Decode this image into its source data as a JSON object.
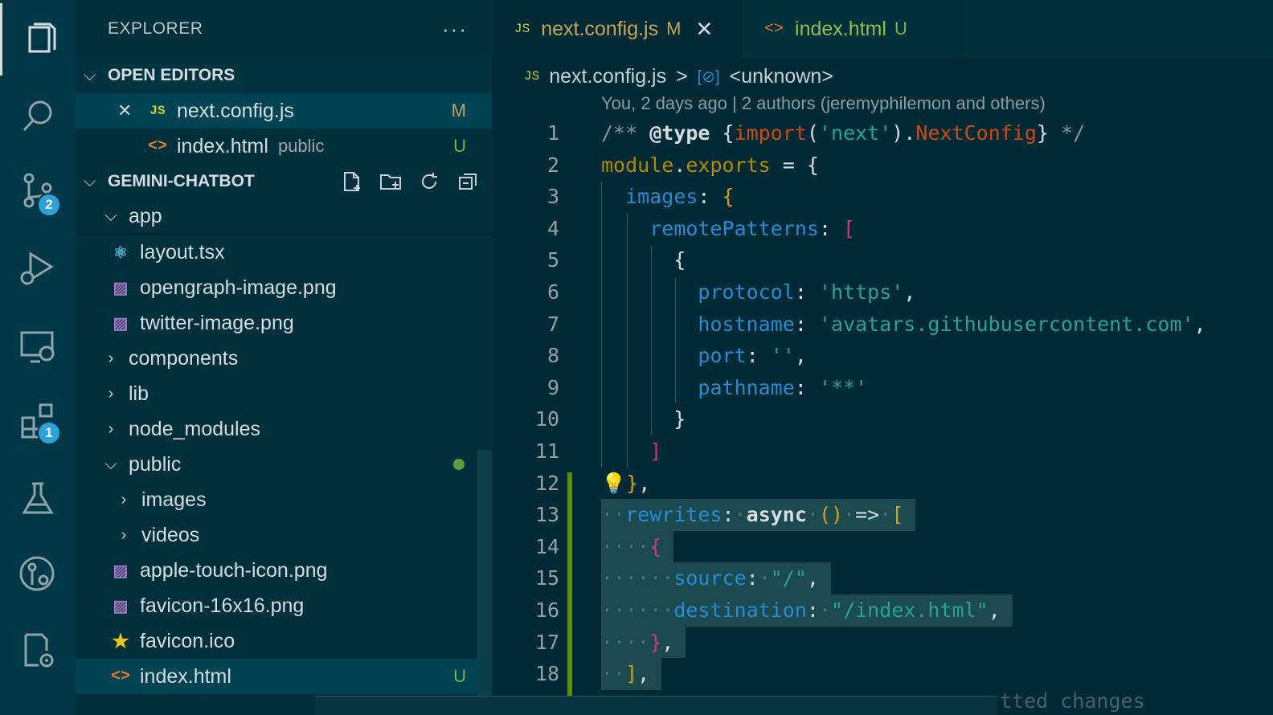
{
  "activity_bar": {
    "items": [
      {
        "name": "explorer-icon"
      },
      {
        "name": "search-icon"
      },
      {
        "name": "source-control-icon",
        "badge": "2"
      },
      {
        "name": "run-debug-icon"
      },
      {
        "name": "remote-explorer-icon"
      },
      {
        "name": "extensions-icon",
        "badge": "1"
      },
      {
        "name": "testing-icon"
      },
      {
        "name": "git-graph-icon"
      },
      {
        "name": "settings-sync-icon"
      }
    ]
  },
  "sidebar": {
    "title": "EXPLORER",
    "more": "···",
    "open_editors": {
      "title": "OPEN EDITORS",
      "items": [
        {
          "close": "✕",
          "icon": "JS",
          "name": "next.config.js",
          "folder": "",
          "status": "M"
        },
        {
          "icon": "<>",
          "name": "index.html",
          "folder": "public",
          "status": "U"
        }
      ]
    },
    "project": {
      "title": "GEMINI-CHATBOT",
      "tree": [
        {
          "type": "folder-open",
          "name": "app"
        },
        {
          "type": "react",
          "name": "layout.tsx"
        },
        {
          "type": "image",
          "name": "opengraph-image.png"
        },
        {
          "type": "image",
          "name": "twitter-image.png"
        },
        {
          "type": "folder",
          "name": "components"
        },
        {
          "type": "folder",
          "name": "lib"
        },
        {
          "type": "folder",
          "name": "node_modules"
        },
        {
          "type": "folder-open",
          "name": "public"
        },
        {
          "type": "folder",
          "name": "images"
        },
        {
          "type": "folder",
          "name": "videos"
        },
        {
          "type": "image",
          "name": "apple-touch-icon.png"
        },
        {
          "type": "image",
          "name": "favicon-16x16.png"
        },
        {
          "type": "star",
          "name": "favicon.ico"
        },
        {
          "type": "html",
          "name": "index.html",
          "status": "U"
        }
      ]
    }
  },
  "editor": {
    "tabs": [
      {
        "icon": "JS",
        "name": "next.config.js",
        "status": "M",
        "close": "✕",
        "active": true
      },
      {
        "icon": "<>",
        "name": "index.html",
        "status": "U",
        "active": false
      }
    ],
    "breadcrumb": {
      "file_icon": "JS",
      "file": "next.config.js",
      "separator": ">",
      "symbol": "<unknown>"
    },
    "blame": "You, 2 days ago | 2 authors (jeremyphilemon and others)",
    "line_numbers": [
      "1",
      "2",
      "3",
      "4",
      "5",
      "6",
      "7",
      "8",
      "9",
      "10",
      "11",
      "12",
      "13",
      "14",
      "15",
      "16",
      "17",
      "18"
    ],
    "bottom_ghost": "tted changes"
  },
  "colors": {
    "background": "#002b36",
    "sidebar": "#00303c",
    "activity": "#003847",
    "accent_badge": "#2aa1d8",
    "modified": "#c9a45c",
    "untracked": "#7cb342"
  }
}
